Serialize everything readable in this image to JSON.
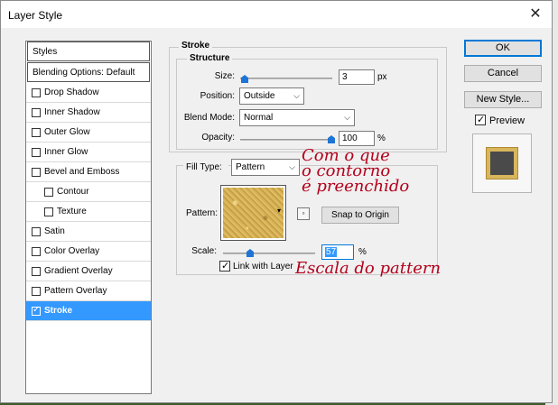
{
  "window": {
    "title": "Layer Style"
  },
  "style_list": {
    "header": "Styles",
    "blending": "Blending Options: Default",
    "items": [
      {
        "label": "Drop Shadow",
        "checked": false,
        "indent": false
      },
      {
        "label": "Inner Shadow",
        "checked": false,
        "indent": false
      },
      {
        "label": "Outer Glow",
        "checked": false,
        "indent": false
      },
      {
        "label": "Inner Glow",
        "checked": false,
        "indent": false
      },
      {
        "label": "Bevel and Emboss",
        "checked": false,
        "indent": false
      },
      {
        "label": "Contour",
        "checked": false,
        "indent": true
      },
      {
        "label": "Texture",
        "checked": false,
        "indent": true
      },
      {
        "label": "Satin",
        "checked": false,
        "indent": false
      },
      {
        "label": "Color Overlay",
        "checked": false,
        "indent": false
      },
      {
        "label": "Gradient Overlay",
        "checked": false,
        "indent": false
      },
      {
        "label": "Pattern Overlay",
        "checked": false,
        "indent": false
      },
      {
        "label": "Stroke",
        "checked": true,
        "indent": false,
        "selected": true
      }
    ]
  },
  "stroke": {
    "group_title": "Stroke",
    "structure_title": "Structure",
    "size_label": "Size:",
    "size_value": "3",
    "size_unit": "px",
    "position_label": "Position:",
    "position_value": "Outside",
    "blend_label": "Blend Mode:",
    "blend_value": "Normal",
    "opacity_label": "Opacity:",
    "opacity_value": "100",
    "opacity_unit": "%",
    "fill_type_label": "Fill Type:",
    "fill_type_value": "Pattern",
    "pattern_label": "Pattern:",
    "snap_label": "Snap to Origin",
    "scale_label": "Scale:",
    "scale_value": "57",
    "scale_unit": "%",
    "link_label": "Link with Layer",
    "link_checked": true
  },
  "buttons": {
    "ok": "OK",
    "cancel": "Cancel",
    "new_style": "New Style...",
    "preview": "Preview",
    "preview_checked": true
  },
  "annotations": {
    "fill_note_line1": "Com o que",
    "fill_note_line2": "o contorno",
    "fill_note_line3": "é preenchido",
    "scale_note": "Escala do pattern"
  },
  "colors": {
    "selection": "#3399ff",
    "slider_thumb": "#1e74d6",
    "annotation": "#b3001b"
  }
}
